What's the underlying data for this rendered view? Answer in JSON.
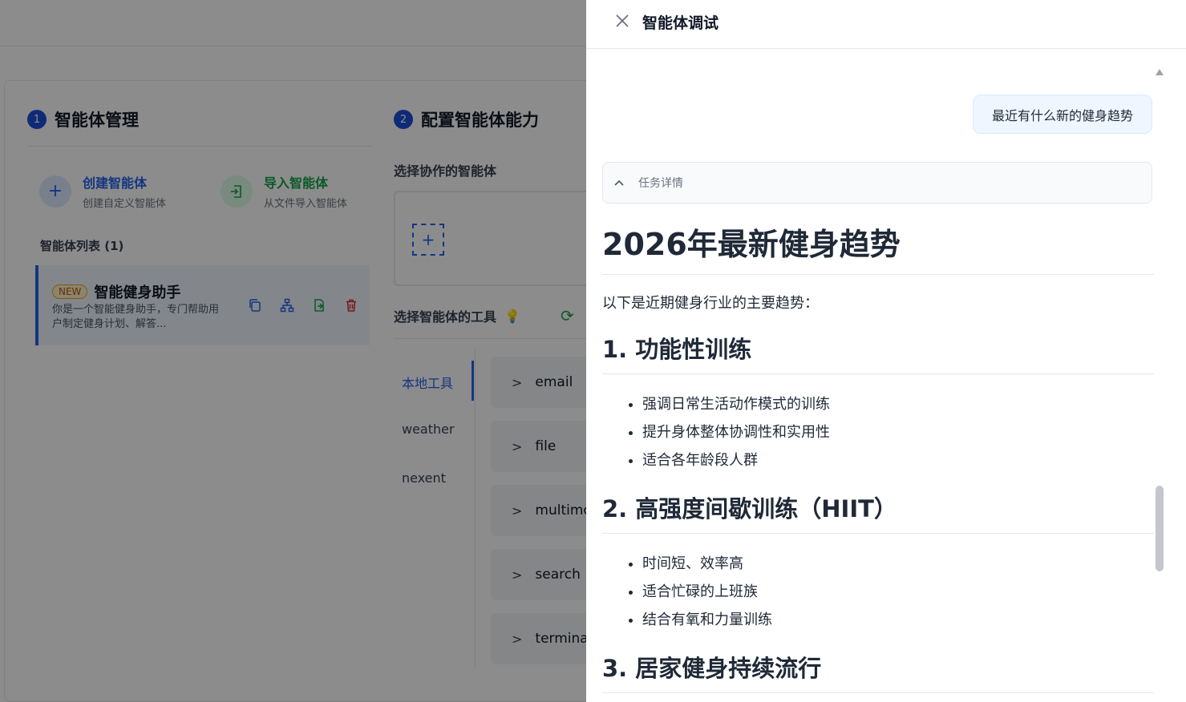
{
  "background": {
    "step1": {
      "num": "1",
      "title": "智能体管理"
    },
    "step2": {
      "num": "2",
      "title": "配置智能体能力"
    },
    "create": {
      "title": "创建智能体",
      "subtitle": "创建自定义智能体"
    },
    "import": {
      "title": "导入智能体",
      "subtitle": "从文件导入智能体"
    },
    "list_title": "智能体列表 (1)",
    "agent": {
      "badge": "NEW",
      "name": "智能健身助手",
      "description": "你是一个智能健身助手，专门帮助用户制定健身计划、解答..."
    },
    "collab_title": "选择协作的智能体",
    "tools_title": "选择智能体的工具",
    "tool_tabs": [
      "本地工具",
      "weather",
      "nexent"
    ],
    "tools": [
      "email",
      "file",
      "multimo",
      "search",
      "terminal"
    ]
  },
  "drawer": {
    "title": "智能体调试",
    "user_message": "最近有什么新的健身趋势",
    "task_details_label": "任务详情",
    "content": {
      "h1": "2026年最新健身趋势",
      "intro": "以下是近期健身行业的主要趋势：",
      "sections": [
        {
          "heading": "1. 功能性训练",
          "items": [
            "强调日常生活动作模式的训练",
            "提升身体整体协调性和实用性",
            "适合各年龄段人群"
          ]
        },
        {
          "heading": "2. 高强度间歇训练（HIIT）",
          "items": [
            "时间短、效率高",
            "适合忙碌的上班族",
            "结合有氧和力量训练"
          ]
        },
        {
          "heading": "3. 居家健身持续流行",
          "items": []
        }
      ]
    }
  },
  "colors": {
    "accent": "#2563eb",
    "success": "#16a34a",
    "danger": "#dc2626",
    "overlay": "rgba(0,0,0,0.45)"
  }
}
